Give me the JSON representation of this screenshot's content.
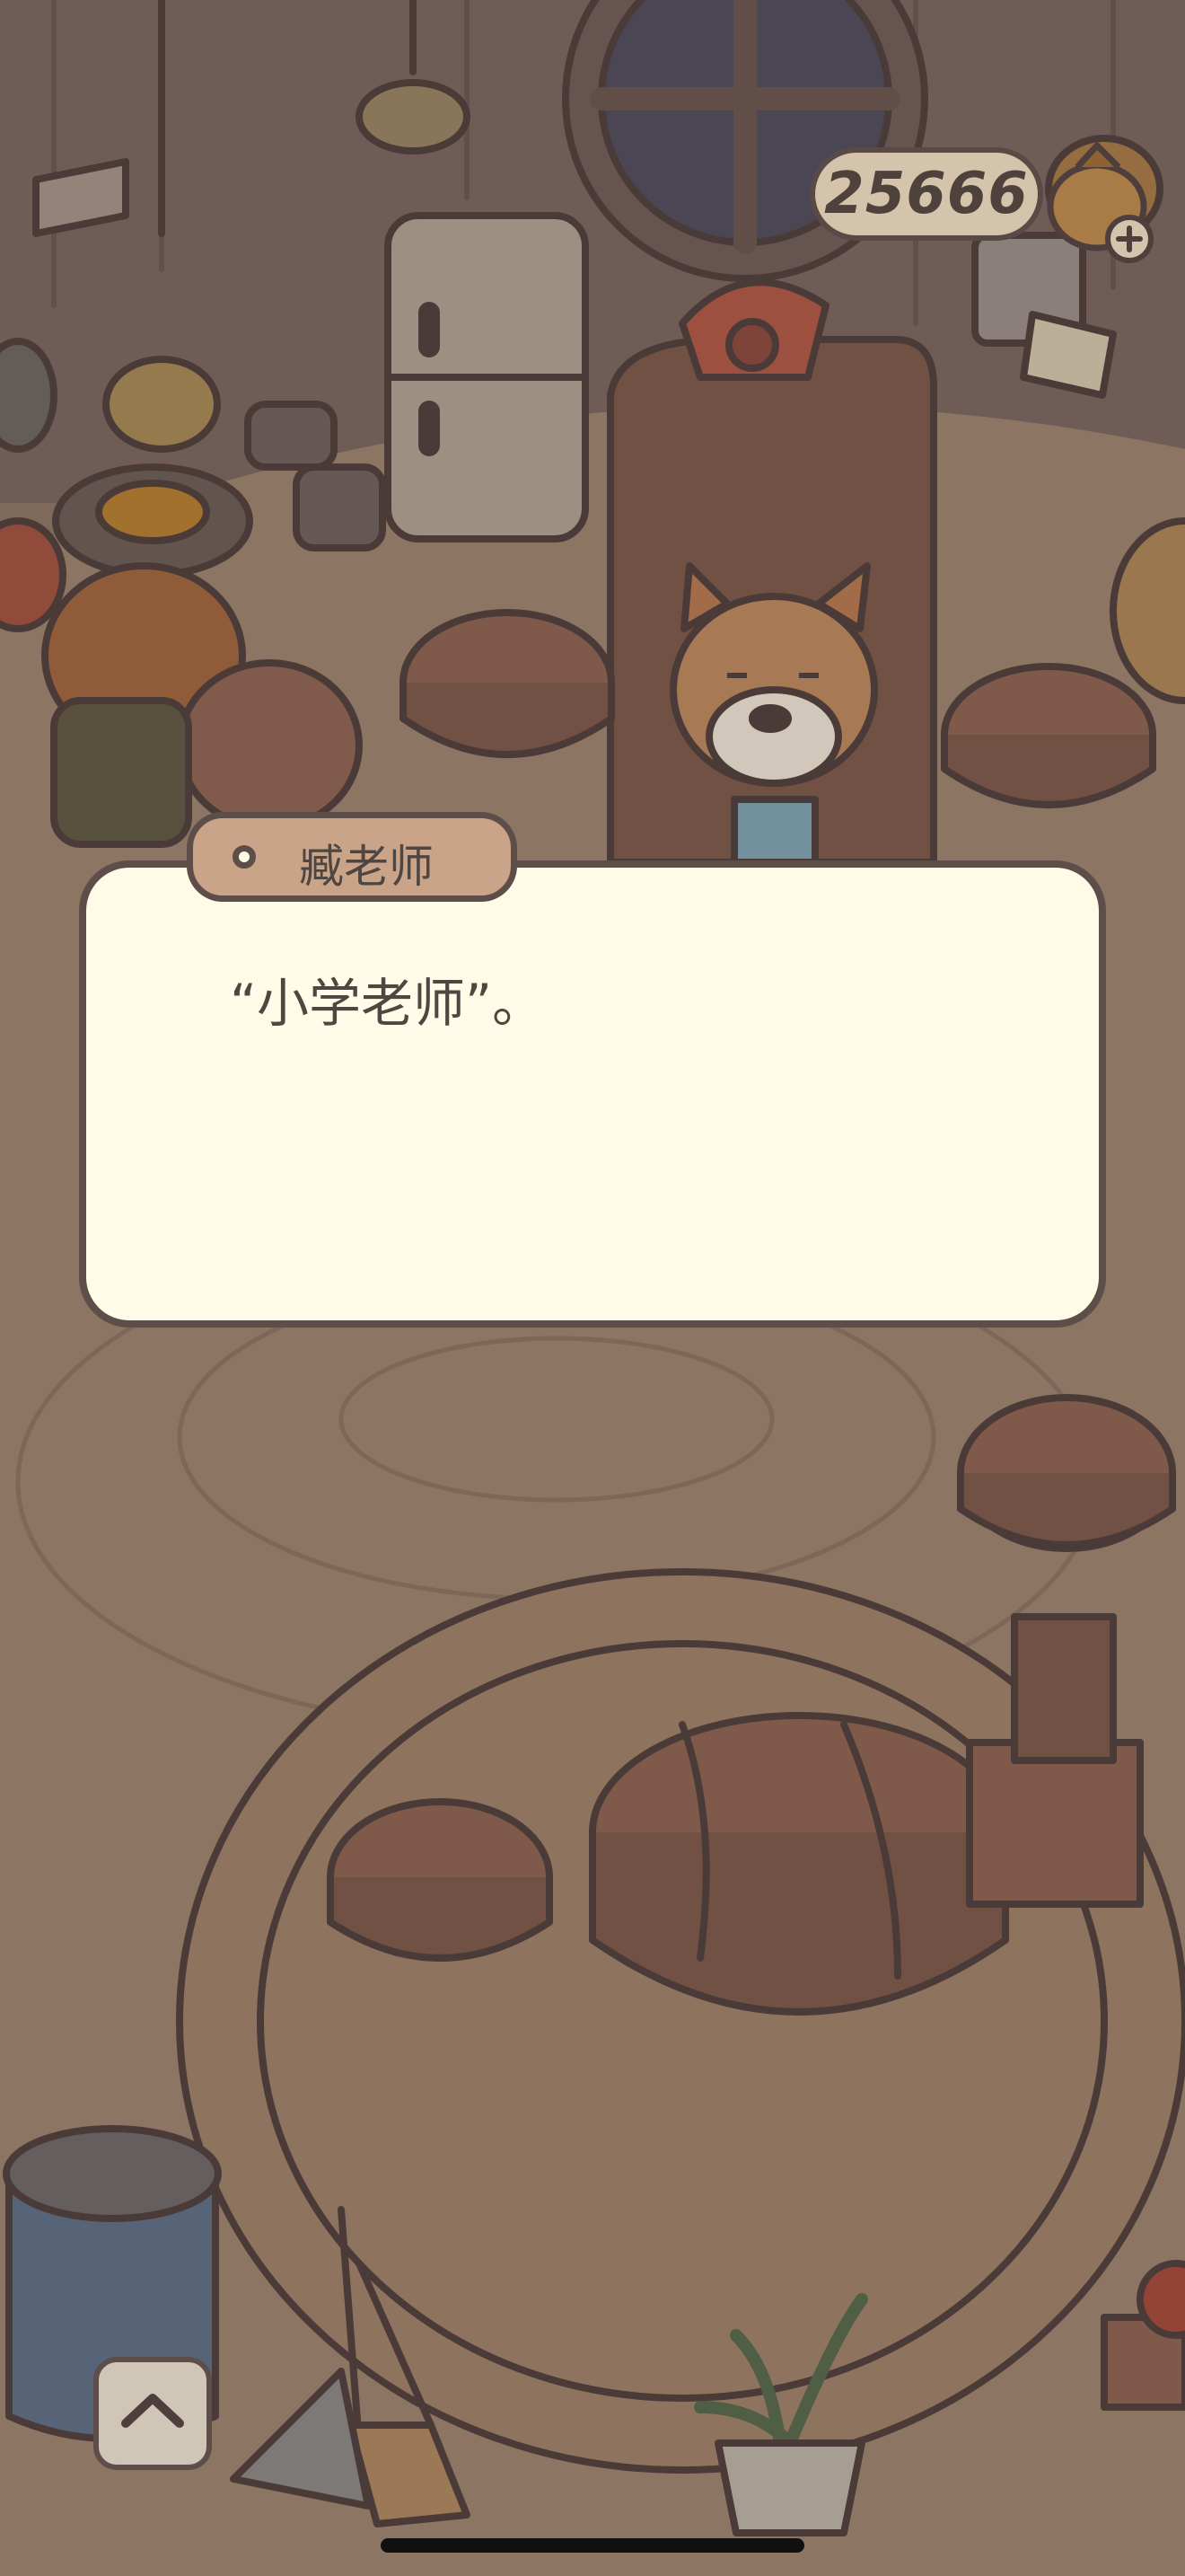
{
  "hud": {
    "coins": "25666",
    "add_icon": "plus-icon"
  },
  "dialog": {
    "speaker": "臧老师",
    "text": "“小学老师”。"
  },
  "controls": {
    "collapse_icon": "chevron-up-icon"
  }
}
